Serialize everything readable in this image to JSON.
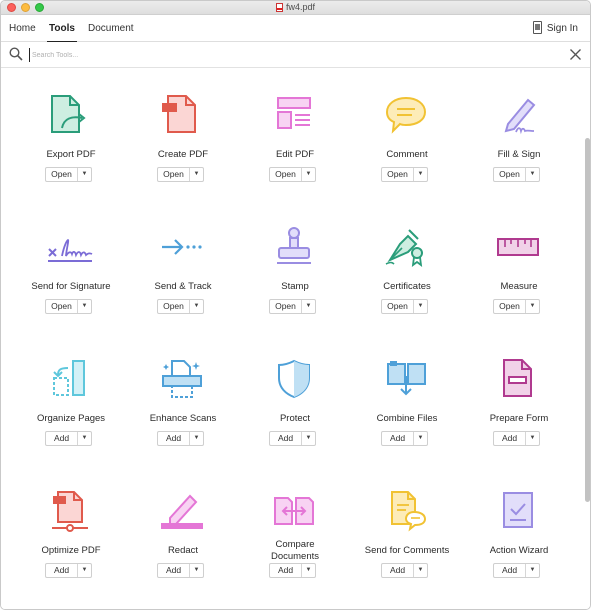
{
  "window": {
    "title": "fw4.pdf"
  },
  "tabs": [
    {
      "label": "Home"
    },
    {
      "label": "Tools"
    },
    {
      "label": "Document"
    }
  ],
  "header": {
    "signin_label": "Sign In"
  },
  "search": {
    "placeholder": "Search Tools..."
  },
  "colors": {
    "green": "#2a9d7a",
    "red": "#e56a66",
    "pink": "#e476d6",
    "yellow": "#f1c233",
    "purple": "#9a8de2",
    "blue": "#4ea0d8",
    "magenta": "#b03a8f",
    "cyan": "#5ec7dc",
    "orange_dark": "#e05a4c"
  },
  "tools": [
    {
      "label": "Export PDF",
      "button": "Open",
      "icon": "export-pdf-icon"
    },
    {
      "label": "Create PDF",
      "button": "Open",
      "icon": "create-pdf-icon"
    },
    {
      "label": "Edit PDF",
      "button": "Open",
      "icon": "edit-pdf-icon"
    },
    {
      "label": "Comment",
      "button": "Open",
      "icon": "comment-icon"
    },
    {
      "label": "Fill & Sign",
      "button": "Open",
      "icon": "fill-sign-icon"
    },
    {
      "label": "Send for Signature",
      "button": "Open",
      "icon": "send-for-signature-icon"
    },
    {
      "label": "Send & Track",
      "button": "Open",
      "icon": "send-track-icon"
    },
    {
      "label": "Stamp",
      "button": "Open",
      "icon": "stamp-icon"
    },
    {
      "label": "Certificates",
      "button": "Open",
      "icon": "certificates-icon"
    },
    {
      "label": "Measure",
      "button": "Open",
      "icon": "measure-icon"
    },
    {
      "label": "Organize Pages",
      "button": "Add",
      "icon": "organize-pages-icon"
    },
    {
      "label": "Enhance Scans",
      "button": "Add",
      "icon": "enhance-scans-icon"
    },
    {
      "label": "Protect",
      "button": "Add",
      "icon": "protect-icon"
    },
    {
      "label": "Combine Files",
      "button": "Add",
      "icon": "combine-files-icon"
    },
    {
      "label": "Prepare Form",
      "button": "Add",
      "icon": "prepare-form-icon"
    },
    {
      "label": "Optimize PDF",
      "button": "Add",
      "icon": "optimize-pdf-icon"
    },
    {
      "label": "Redact",
      "button": "Add",
      "icon": "redact-icon"
    },
    {
      "label": "Compare Documents",
      "label_line1": "Compare",
      "label_line2": "Documents",
      "button": "Add",
      "icon": "compare-documents-icon"
    },
    {
      "label": "Send for Comments",
      "button": "Add",
      "icon": "send-for-comments-icon"
    },
    {
      "label": "Action Wizard",
      "button": "Add",
      "icon": "action-wizard-icon"
    }
  ]
}
